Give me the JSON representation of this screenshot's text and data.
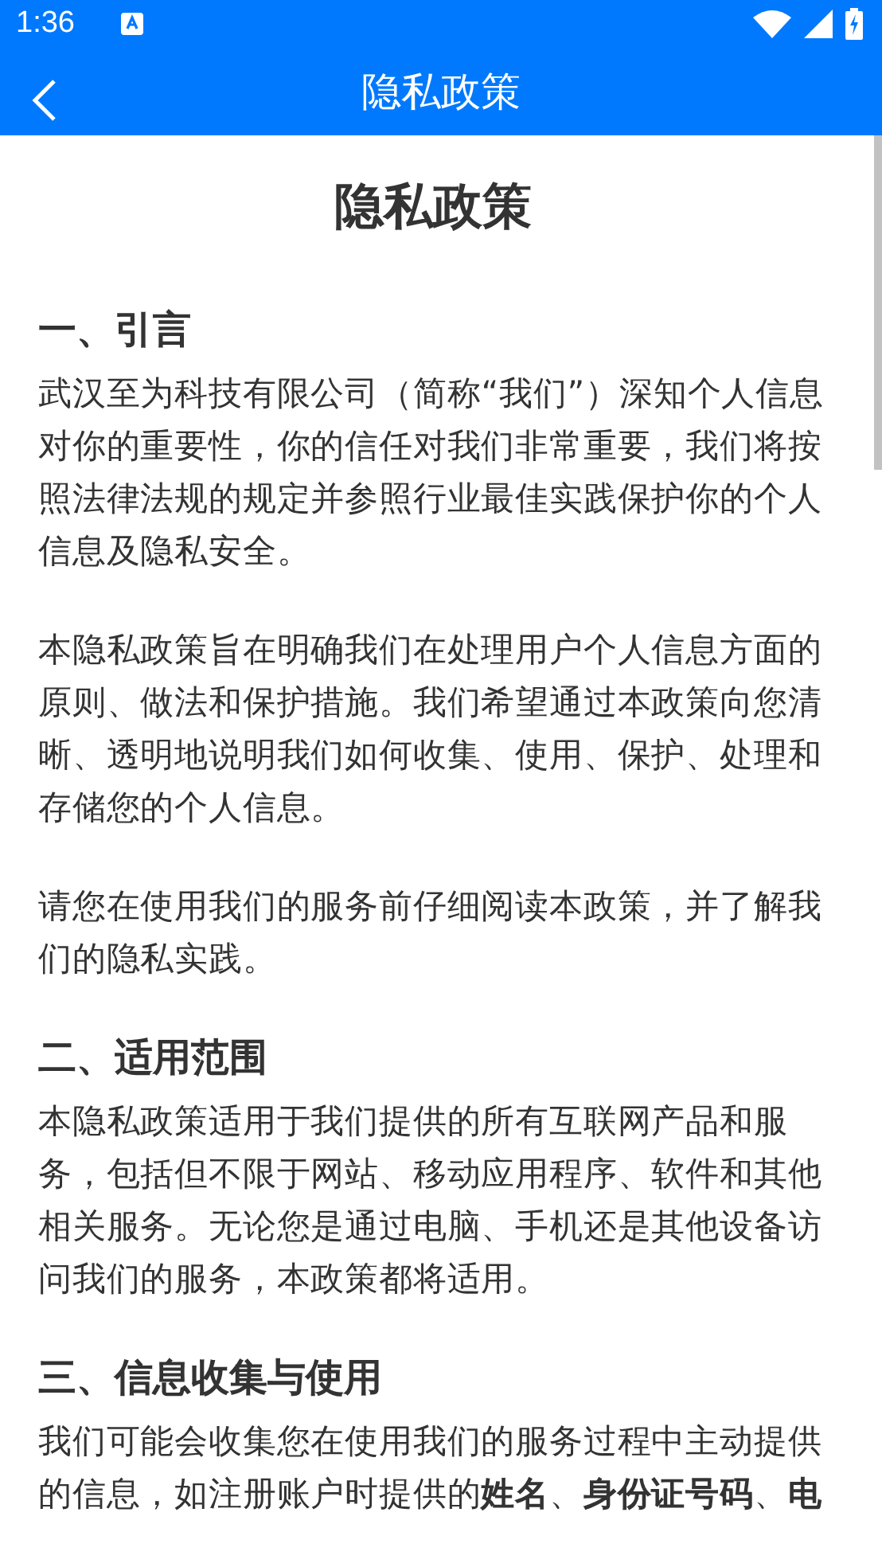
{
  "status_bar": {
    "time": "1:36"
  },
  "app_bar": {
    "title": "隐私政策"
  },
  "document": {
    "title": "隐私政策",
    "sections": [
      {
        "heading": "一、引言",
        "paragraphs": [
          "武汉至为科技有限公司（简称“我们”）深知个人信息对你的重要性，你的信任对我们非常重要，我们将按照法律法规的规定并参照行业最佳实践保护你的个人信息及隐私安全。",
          "本隐私政策旨在明确我们在处理用户个人信息方面的原则、做法和保护措施。我们希望通过本政策向您清晰、透明地说明我们如何收集、使用、保护、处理和存储您的个人信息。",
          "请您在使用我们的服务前仔细阅读本政策，并了解我们的隐私实践。"
        ]
      },
      {
        "heading": "二、适用范围",
        "paragraphs": [
          "本隐私政策适用于我们提供的所有互联网产品和服务，包括但不限于网站、移动应用程序、软件和其他相关服务。无论您是通过电脑、手机还是其他设备访问我们的服务，本政策都将适用。"
        ]
      },
      {
        "heading": "三、信息收集与使用",
        "paragraphs": [
          "我们可能会收集您在使用我们的服务过程中主动提供的信息，如注册账户时提供的**姓名**、**身份证号码**、**电**"
        ]
      }
    ]
  }
}
